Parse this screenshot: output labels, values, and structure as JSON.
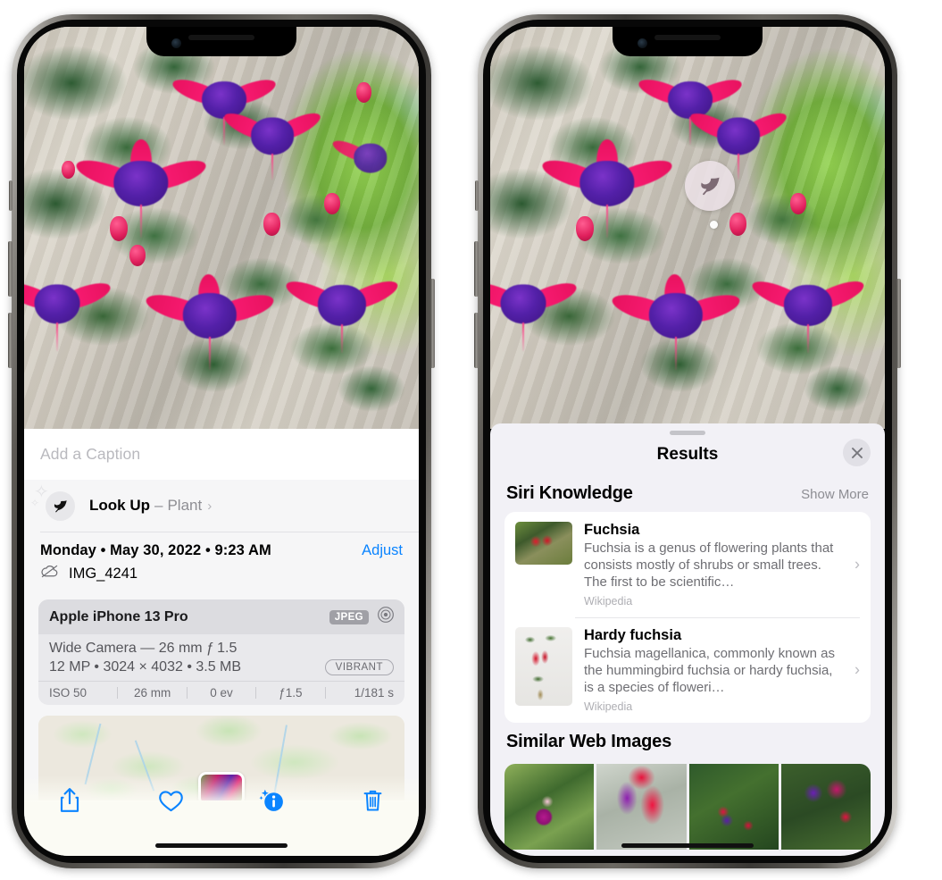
{
  "left_phone": {
    "caption_placeholder": "Add a Caption",
    "lookup": {
      "title": "Look Up",
      "dash": "–",
      "subject": "Plant",
      "chevron": "›",
      "icon": "leaf-icon"
    },
    "date_line": "Monday • May 30, 2022 • 9:23 AM",
    "adjust_label": "Adjust",
    "file_name": "IMG_4241",
    "cloud_icon": "icloud-slash-icon",
    "metadata": {
      "device": "Apple iPhone 13 Pro",
      "format_badge": "JPEG",
      "raw_icon": "aperture-icon",
      "lens_line": "Wide Camera — 26 mm ƒ 1.5",
      "size_line": "12 MP • 3024 × 4032 • 3.5 MB",
      "style_badge": "VIBRANT",
      "exif": [
        "ISO 50",
        "26 mm",
        "0 ev",
        "ƒ1.5",
        "1/181 s"
      ]
    },
    "toolbar": [
      {
        "name": "share-button",
        "glyph": "share-icon"
      },
      {
        "name": "favorite-button",
        "glyph": "heart-icon"
      },
      {
        "name": "info-button",
        "glyph": "info-sparkle-icon"
      },
      {
        "name": "delete-button",
        "glyph": "trash-icon"
      }
    ]
  },
  "right_phone": {
    "badge_icon": "leaf-icon",
    "sheet": {
      "title": "Results",
      "close_icon": "close-icon",
      "sections": [
        {
          "title": "Siri Knowledge",
          "action": "Show More"
        },
        {
          "title": "Similar Web Images",
          "action": ""
        }
      ],
      "knowledge": [
        {
          "name": "Fuchsia",
          "description": "Fuchsia is a genus of flowering plants that consists mostly of shrubs or small trees. The first to be scientific…",
          "source": "Wikipedia",
          "chevron": "›"
        },
        {
          "name": "Hardy fuchsia",
          "description": "Fuchsia magellanica, commonly known as the hummingbird fuchsia or hardy fuchsia, is a species of floweri…",
          "source": "Wikipedia",
          "chevron": "›"
        }
      ],
      "web_images": [
        "web-image-1",
        "web-image-2",
        "web-image-3",
        "web-image-4"
      ]
    }
  },
  "colors": {
    "accent_blue": "#0a84ff",
    "sheet_bg": "#f2f1f6",
    "card_bg": "#ffffff",
    "meta_card_bg": "#e9e9ec",
    "secondary_text": "#8e8e93"
  }
}
